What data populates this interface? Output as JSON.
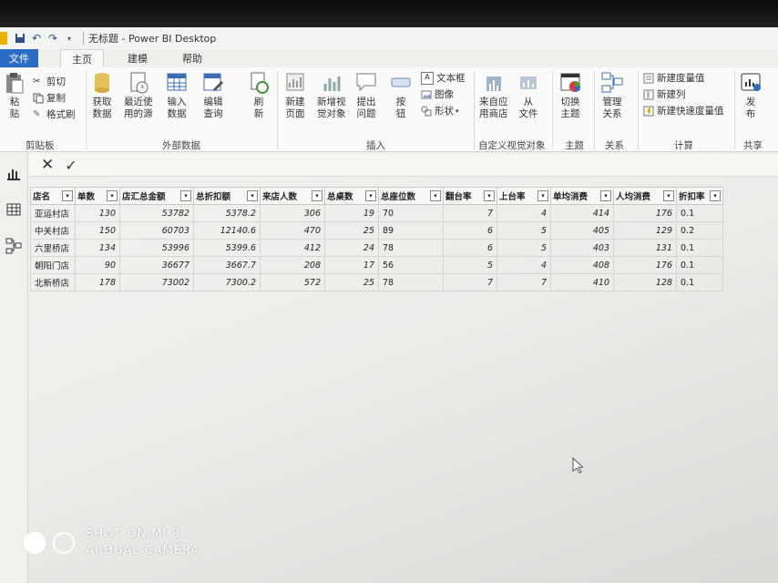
{
  "window": {
    "title": "无标题 - Power BI Desktop"
  },
  "tabs": [
    "文件",
    "主页",
    "建模",
    "帮助"
  ],
  "ribbon": {
    "clipboard": {
      "paste": "粘\n贴",
      "cut": "剪切",
      "copy": "复制",
      "format_painter": "格式刷",
      "label": "剪贴板"
    },
    "external": {
      "get_data": "获取\n数据",
      "recent": "最近使\n用的源",
      "enter": "输入\n数据",
      "edit": "编辑\n查询",
      "refresh": "刷\n新",
      "label": "外部数据"
    },
    "insert": {
      "new_page": "新建\n页面",
      "new_visual": "新增视\n觉对象",
      "ask": "提出\n问题",
      "button": "按\n钮",
      "textbox": "文本框",
      "image": "图像",
      "shape": "形状",
      "label": "插入"
    },
    "custom": {
      "from_store": "来自应\n用商店",
      "from_file": "从\n文件",
      "label": "自定义视觉对象"
    },
    "theme": {
      "switch": "切换\n主题",
      "label": "主题"
    },
    "relation": {
      "manage": "管理\n关系",
      "label": "关系"
    },
    "calc": {
      "new_measure": "新建度量值",
      "new_column": "新建列",
      "new_quick": "新建快速度量值",
      "label": "计算"
    },
    "share": {
      "publish": "发\n布",
      "label": "共享"
    }
  },
  "formula_bar": {
    "cancel": "✕",
    "commit": "✓"
  },
  "table": {
    "columns": [
      "店名",
      "单数",
      "店汇总金额",
      "总折扣额",
      "来店人数",
      "总桌数",
      "总座位数",
      "翻台率",
      "上台率",
      "单均消费",
      "人均消费",
      "折扣率"
    ],
    "rows": [
      [
        "亚运村店",
        "130",
        "53782",
        "5378.2",
        "306",
        "19",
        "70",
        "7",
        "4",
        "414",
        "176",
        "0.1"
      ],
      [
        "中关村店",
        "150",
        "60703",
        "12140.6",
        "470",
        "25",
        "89",
        "6",
        "5",
        "405",
        "129",
        "0.2"
      ],
      [
        "六里桥店",
        "134",
        "53996",
        "5399.6",
        "412",
        "24",
        "78",
        "6",
        "5",
        "403",
        "131",
        "0.1"
      ],
      [
        "朝阳门店",
        "90",
        "36677",
        "3667.7",
        "208",
        "17",
        "56",
        "5",
        "4",
        "408",
        "176",
        "0.1"
      ],
      [
        "北新桥店",
        "178",
        "73002",
        "7300.2",
        "572",
        "25",
        "78",
        "7",
        "7",
        "410",
        "128",
        "0.1"
      ]
    ]
  },
  "watermark": {
    "line1": "SHOT ON MI 8",
    "line2": "AI DUAL CAMERA"
  }
}
